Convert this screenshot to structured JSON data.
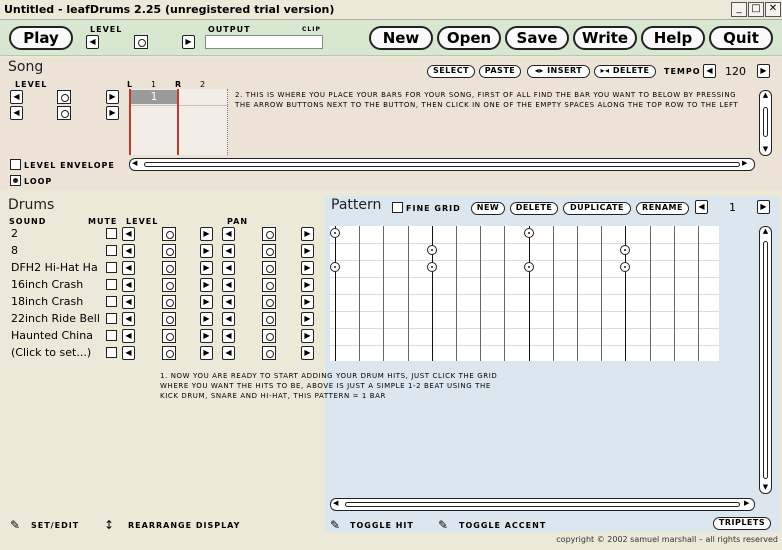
{
  "window": {
    "title": "Untitled - leafDrums 2.25 (unregistered trial version)"
  },
  "toolbar": {
    "play": "Play",
    "level_label": "LEVEL",
    "output_label": "OUTPUT",
    "clip_label": "CLIP",
    "new": "New",
    "open": "Open",
    "save": "Save",
    "write": "Write",
    "help": "Help",
    "quit": "Quit"
  },
  "song": {
    "title": "Song",
    "level_label": "LEVEL",
    "select": "SELECT",
    "paste": "PASTE",
    "insert": "INSERT",
    "delete": "DELETE",
    "tempo_label": "TEMPO",
    "tempo_value": "120",
    "col_l": "L",
    "col_1": "1",
    "col_r": "R",
    "col_2": "2",
    "bar_value": "1",
    "instructions": "2. THIS IS WHERE YOU PLACE YOUR BARS FOR YOUR SONG, FIRST OF ALL FIND THE BAR YOU WANT TO BELOW BY PRESSING THE ARROW BUTTONS NEXT TO THE BUTTON, THEN CLICK IN ONE OF THE EMPTY SPACES ALONG THE TOP ROW TO THE LEFT",
    "level_envelope": "LEVEL ENVELOPE",
    "loop": "LOOP"
  },
  "drums": {
    "title": "Drums",
    "col_sound": "SOUND",
    "col_mute": "MUTE",
    "col_level": "LEVEL",
    "col_pan": "PAN",
    "rows": [
      "2",
      "8",
      "DFH2 Hi-Hat Ha",
      "16inch Crash",
      "18inch Crash",
      "22inch Ride Bell",
      "Haunted China",
      "(Click to set...)"
    ]
  },
  "pattern": {
    "title": "Pattern",
    "fine_grid": "FINE GRID",
    "new": "NEW",
    "delete": "DELETE",
    "duplicate": "DUPLICATE",
    "rename": "RENAME",
    "pattern_number": "1",
    "instructions": "1. NOW YOU ARE READY TO START ADDING YOUR DRUM HITS, JUST CLICK THE GRID WHERE YOU WANT THE HITS TO BE, ABOVE IS JUST A SIMPLE 1-2 BEAT USING THE KICK DRUM, SNARE AND HI-HAT, THIS PATTERN = 1 BAR",
    "triplets": "TRIPLETS"
  },
  "bottom": {
    "set_edit": "SET/EDIT",
    "rearrange": "REARRANGE DISPLAY",
    "toggle_hit": "TOGGLE HIT",
    "toggle_accent": "TOGGLE ACCENT",
    "copyright": "copyright © 2002 samuel marshall – all rights reserved"
  }
}
